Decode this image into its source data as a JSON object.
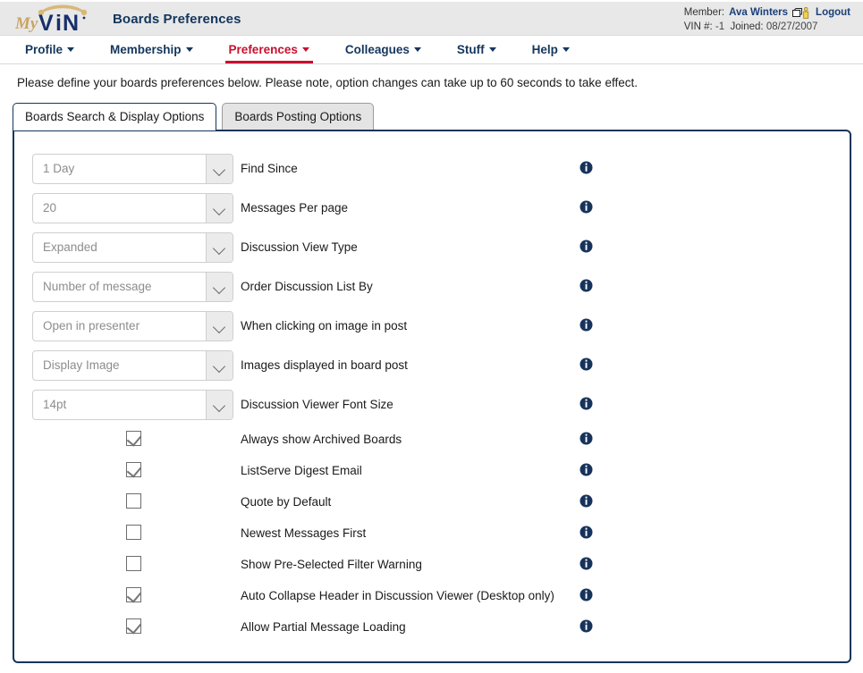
{
  "header": {
    "logo_alt": "MyVIN",
    "logo_my": "My",
    "logo_vin": "VIN",
    "page_title": "Boards Preferences",
    "member_label": "Member:",
    "member_name": "Ava Winters",
    "switch_user_icon": "switch-user-icon",
    "logout_label": "Logout",
    "vin_label": "VIN #:",
    "vin_value": "-1",
    "joined_label": "Joined:",
    "joined_value": "08/27/2007",
    "bg_color": "#e8e8e8",
    "title_color": "#14365c"
  },
  "nav": {
    "active_color": "#c8102e",
    "items": [
      {
        "label": "Profile",
        "active": false,
        "caret": "chevron-down-icon"
      },
      {
        "label": "Membership",
        "active": false,
        "caret": "chevron-down-icon"
      },
      {
        "label": "Preferences",
        "active": true,
        "caret": "chevron-down-icon"
      },
      {
        "label": "Colleagues",
        "active": false,
        "caret": "chevron-down-icon"
      },
      {
        "label": "Stuff",
        "active": false,
        "caret": "chevron-down-icon"
      },
      {
        "label": "Help",
        "active": false,
        "caret": "chevron-down-icon"
      }
    ]
  },
  "intro_text": "Please define your boards preferences below. Please note, option changes can take up to 60 seconds to take effect.",
  "tabs": [
    {
      "label": "Boards Search & Display Options",
      "active": true
    },
    {
      "label": "Boards Posting Options",
      "active": false
    }
  ],
  "panel": {
    "border_color": "#15355b",
    "select_rows": [
      {
        "value": "1 Day",
        "label": "Find Since",
        "info": "info-icon"
      },
      {
        "value": "20",
        "label": "Messages Per page",
        "info": "info-icon"
      },
      {
        "value": "Expanded",
        "label": "Discussion View Type",
        "info": "info-icon"
      },
      {
        "value": "Number of message",
        "label": "Order Discussion List By",
        "info": "info-icon"
      },
      {
        "value": "Open in presenter",
        "label": "When clicking on image in post",
        "info": "info-icon"
      },
      {
        "value": "Display Image",
        "label": "Images displayed in board post",
        "info": "info-icon"
      },
      {
        "value": "14pt",
        "label": "Discussion Viewer Font Size",
        "info": "info-icon"
      }
    ],
    "checkbox_rows": [
      {
        "checked": true,
        "label": "Always show Archived Boards",
        "info": "info-icon"
      },
      {
        "checked": true,
        "label": "ListServe Digest Email",
        "info": "info-icon"
      },
      {
        "checked": false,
        "label": "Quote by Default",
        "info": "info-icon"
      },
      {
        "checked": false,
        "label": "Newest Messages First",
        "info": "info-icon"
      },
      {
        "checked": false,
        "label": "Show Pre-Selected Filter Warning",
        "info": "info-icon"
      },
      {
        "checked": true,
        "label": "Auto Collapse Header in Discussion Viewer (Desktop only)",
        "info": "info-icon"
      },
      {
        "checked": true,
        "label": "Allow Partial Message Loading",
        "info": "info-icon"
      }
    ]
  }
}
